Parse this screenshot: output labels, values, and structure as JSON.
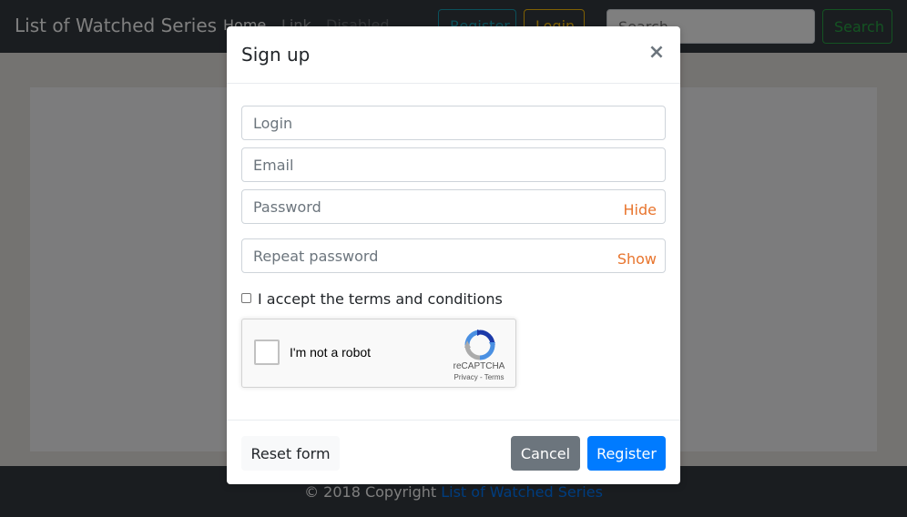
{
  "navbar": {
    "brand": "List of Watched Series",
    "links": {
      "home": "Home",
      "link": "Link",
      "disabled": "Disabled"
    },
    "register_label": "Register",
    "login_label": "Login",
    "search_placeholder": "Search",
    "search_button": "Search"
  },
  "footer": {
    "copyright": "© 2018 Copyright ",
    "site_link": "List of Watched Series"
  },
  "modal": {
    "title": "Sign up",
    "close_symbol": "×",
    "fields": {
      "login_placeholder": "Login",
      "email_placeholder": "Email",
      "password_placeholder": "Password",
      "password_toggle": "Hide",
      "repeat_placeholder": "Repeat password",
      "repeat_toggle": "Show"
    },
    "terms_label": "I accept the terms and conditions",
    "terms_checked": false,
    "recaptcha": {
      "label": "I'm not a robot",
      "brand": "reCAPTCHA",
      "privacy": "Privacy",
      "separator": " - ",
      "terms": "Terms",
      "icon": "recaptcha-logo-icon"
    },
    "buttons": {
      "reset": "Reset form",
      "cancel": "Cancel",
      "register": "Register"
    }
  },
  "colors": {
    "primary": "#007bff",
    "secondary": "#6c757d",
    "toggle_accent": "#e8752e",
    "navbar": "#343a40"
  }
}
